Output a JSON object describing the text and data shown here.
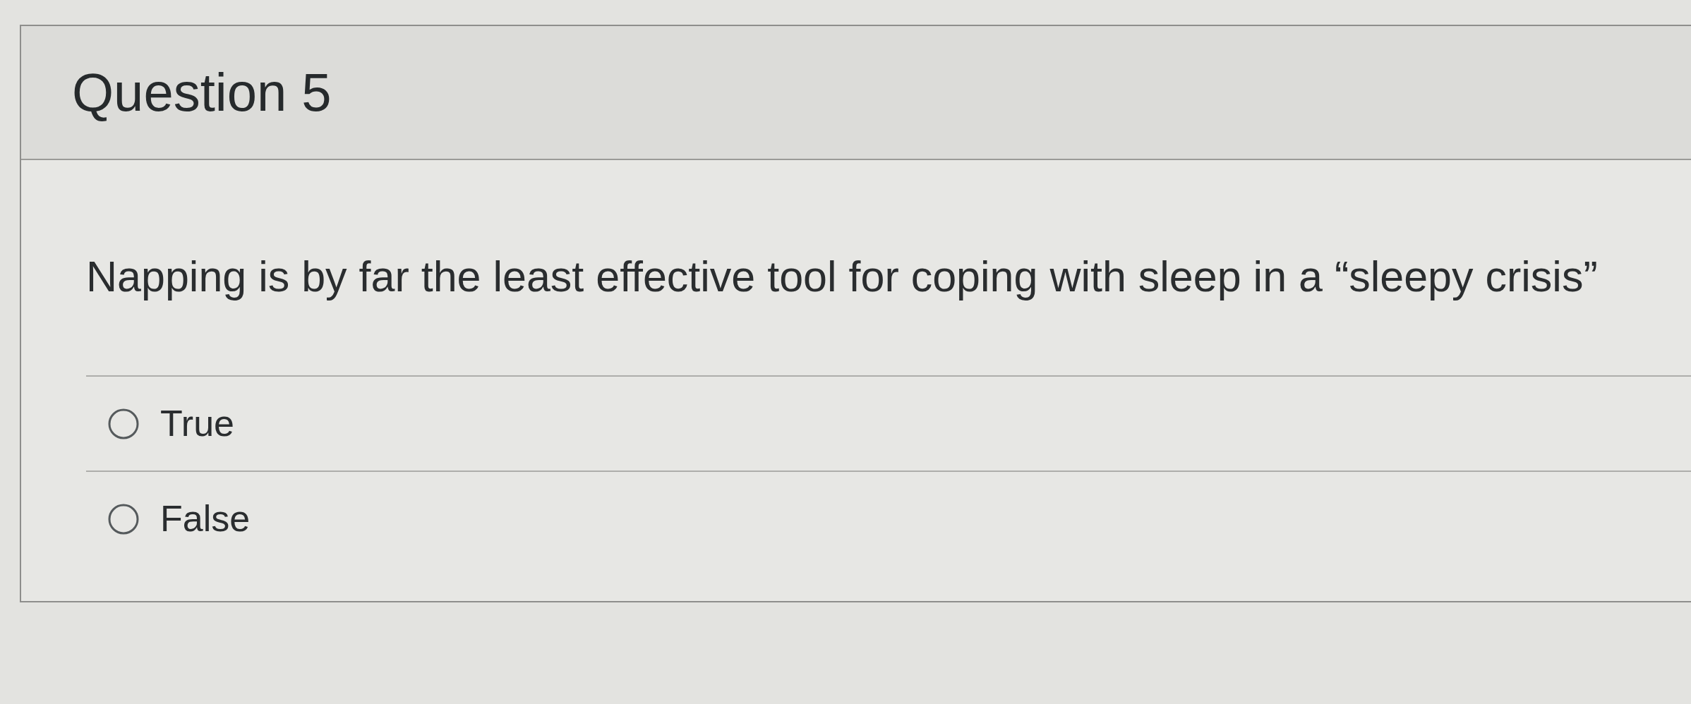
{
  "question": {
    "title": "Question 5",
    "text": "Napping is by far the least effective tool for coping with sleep in a “sleepy crisis”",
    "answers": [
      {
        "label": "True",
        "selected": false
      },
      {
        "label": "False",
        "selected": false
      }
    ]
  }
}
